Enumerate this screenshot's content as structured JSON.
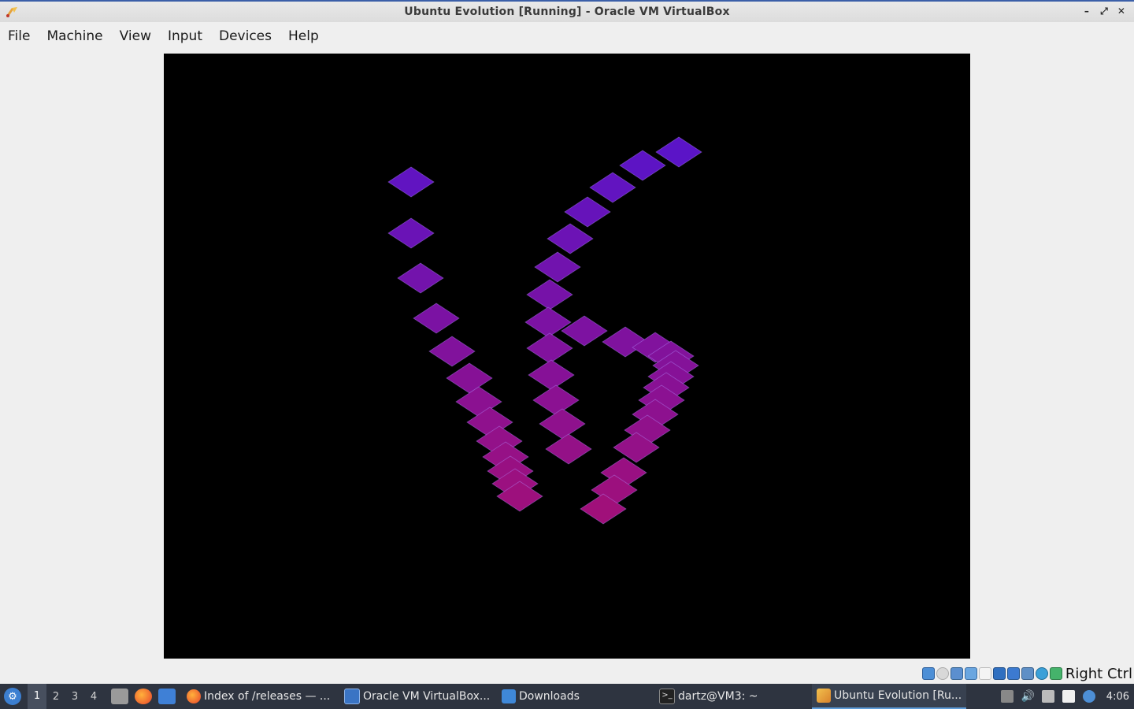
{
  "window": {
    "title": "Ubuntu Evolution [Running] - Oracle VM VirtualBox",
    "controls": [
      "–",
      "⤢",
      "✕"
    ]
  },
  "menu": [
    "File",
    "Machine",
    "View",
    "Input",
    "Devices",
    "Help"
  ],
  "vm_display": {
    "background": "#000000",
    "tile_color_top": "#5a14c8",
    "tile_color_bottom": "#a0107a"
  },
  "statusbar": {
    "host_key": "Right Ctrl",
    "icons": [
      "hard-disk-icon",
      "optical-drive-icon",
      "audio-icon",
      "network-icon",
      "usb-icon",
      "shared-folders-icon",
      "display-icon",
      "recording-icon",
      "cpu-icon",
      "mouse-integration-icon",
      "keyboard-icon"
    ]
  },
  "taskbar": {
    "workspaces": [
      "1",
      "2",
      "3",
      "4"
    ],
    "active_workspace": "1",
    "tasks": [
      {
        "label": "Index of /releases — ...",
        "icon": "firefox-icon",
        "color": "#e8662b"
      },
      {
        "label": "Oracle VM VirtualBox...",
        "icon": "virtualbox-icon",
        "color": "#3a74c4"
      },
      {
        "label": "Downloads",
        "icon": "folder-icon",
        "color": "#3f88d8"
      },
      {
        "label": "dartz@VM3: ~",
        "icon": "terminal-icon",
        "color": "#222222"
      },
      {
        "label": "Ubuntu Evolution [Ru...",
        "icon": "virtualbox-vm-icon",
        "color": "#e0a030"
      }
    ],
    "clock": "4:06"
  }
}
